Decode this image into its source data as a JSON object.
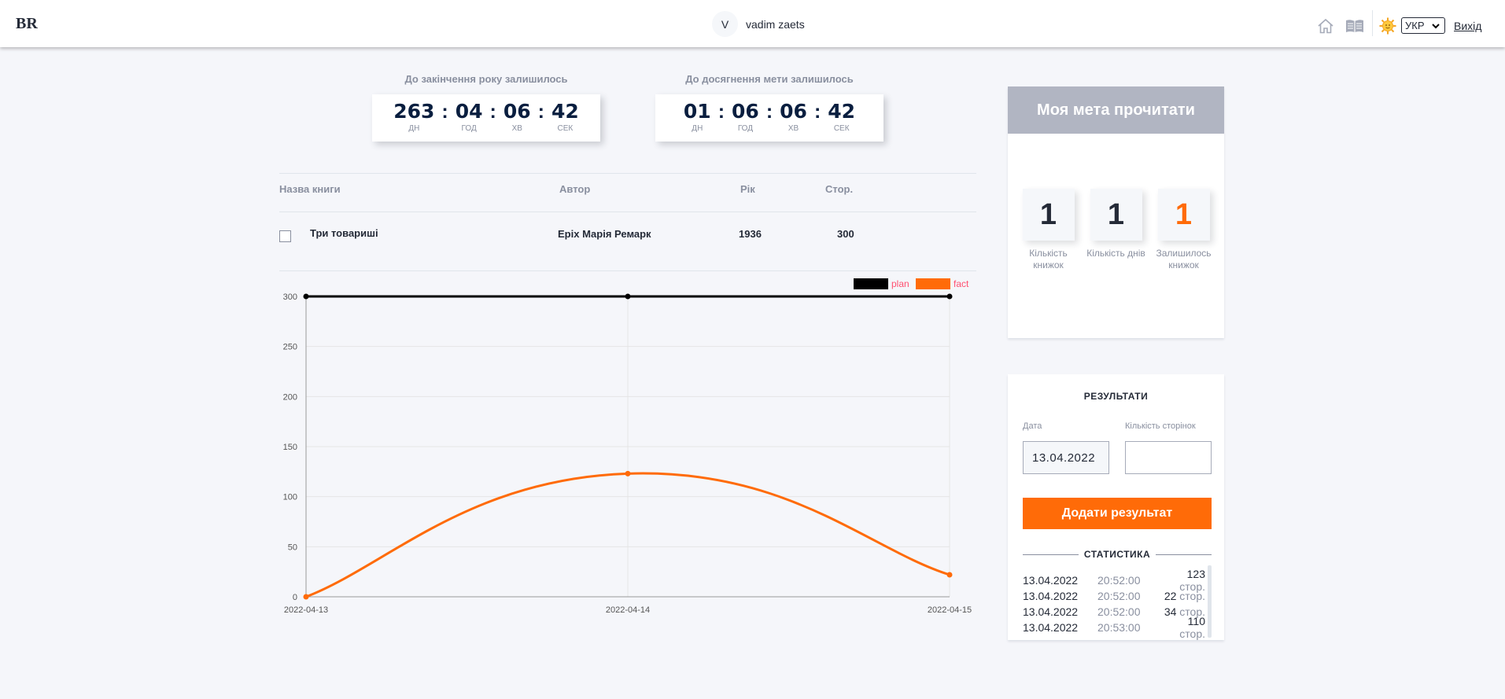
{
  "header": {
    "logo": "BR",
    "user_initial": "V",
    "user_name": "vadim zaets",
    "lang": "УКР",
    "logout": "Вихід",
    "icons": [
      "home-icon",
      "library-icon",
      "sun-icon"
    ]
  },
  "timers": {
    "year": {
      "title": "До закінчення року залишилось",
      "values": [
        "263",
        "04",
        "06",
        "42"
      ],
      "labels": [
        "ДН",
        "ГОД",
        "ХВ",
        "СЕК"
      ]
    },
    "goal": {
      "title": "До досягнення мети залишилось",
      "values": [
        "01",
        "06",
        "06",
        "42"
      ],
      "labels": [
        "ДН",
        "ГОД",
        "ХВ",
        "СЕК"
      ]
    }
  },
  "table": {
    "headers": [
      "Назва книги",
      "Автор",
      "Рік",
      "Стор."
    ],
    "rows": [
      {
        "title": "Три товариші",
        "author": "Еріх Марія Ремарк",
        "year": "1936",
        "pages": "300",
        "checked": false
      }
    ]
  },
  "chart_data": {
    "type": "line",
    "x": [
      "2022-04-13",
      "2022-04-14",
      "2022-04-15"
    ],
    "yticks": [
      0,
      50,
      100,
      150,
      200,
      250,
      300
    ],
    "ylim": [
      0,
      300
    ],
    "legend_position": "top-right",
    "grid": true,
    "series": [
      {
        "name": "plan",
        "color": "#000000",
        "values": [
          300,
          300,
          300
        ]
      },
      {
        "name": "fact",
        "color": "#ff6b08",
        "values": [
          0,
          123,
          22
        ]
      }
    ]
  },
  "goal": {
    "title": "Моя мета прочитати",
    "stats": [
      {
        "value": "1",
        "label": "Кількість книжок"
      },
      {
        "value": "1",
        "label": "Кількість днів"
      },
      {
        "value": "1",
        "label": "Залишилось книжок"
      }
    ]
  },
  "results": {
    "title": "РЕЗУЛЬТАТИ",
    "date_label": "Дата",
    "pages_label": "Кількість сторінок",
    "date_value": "13.04.2022",
    "pages_value": "",
    "button": "Додати результат",
    "stats_title": "СТАТИСТИКА",
    "unit": "стор.",
    "stats": [
      {
        "date": "13.04.2022",
        "time": "20:52:00",
        "pages": "123"
      },
      {
        "date": "13.04.2022",
        "time": "20:52:00",
        "pages": "22"
      },
      {
        "date": "13.04.2022",
        "time": "20:52:00",
        "pages": "34"
      },
      {
        "date": "13.04.2022",
        "time": "20:53:00",
        "pages": "110"
      }
    ]
  },
  "colors": {
    "accent": "#ff6b08",
    "dark": "#242a37",
    "muted": "#898f9f",
    "goal_head": "#b1b5c2"
  }
}
